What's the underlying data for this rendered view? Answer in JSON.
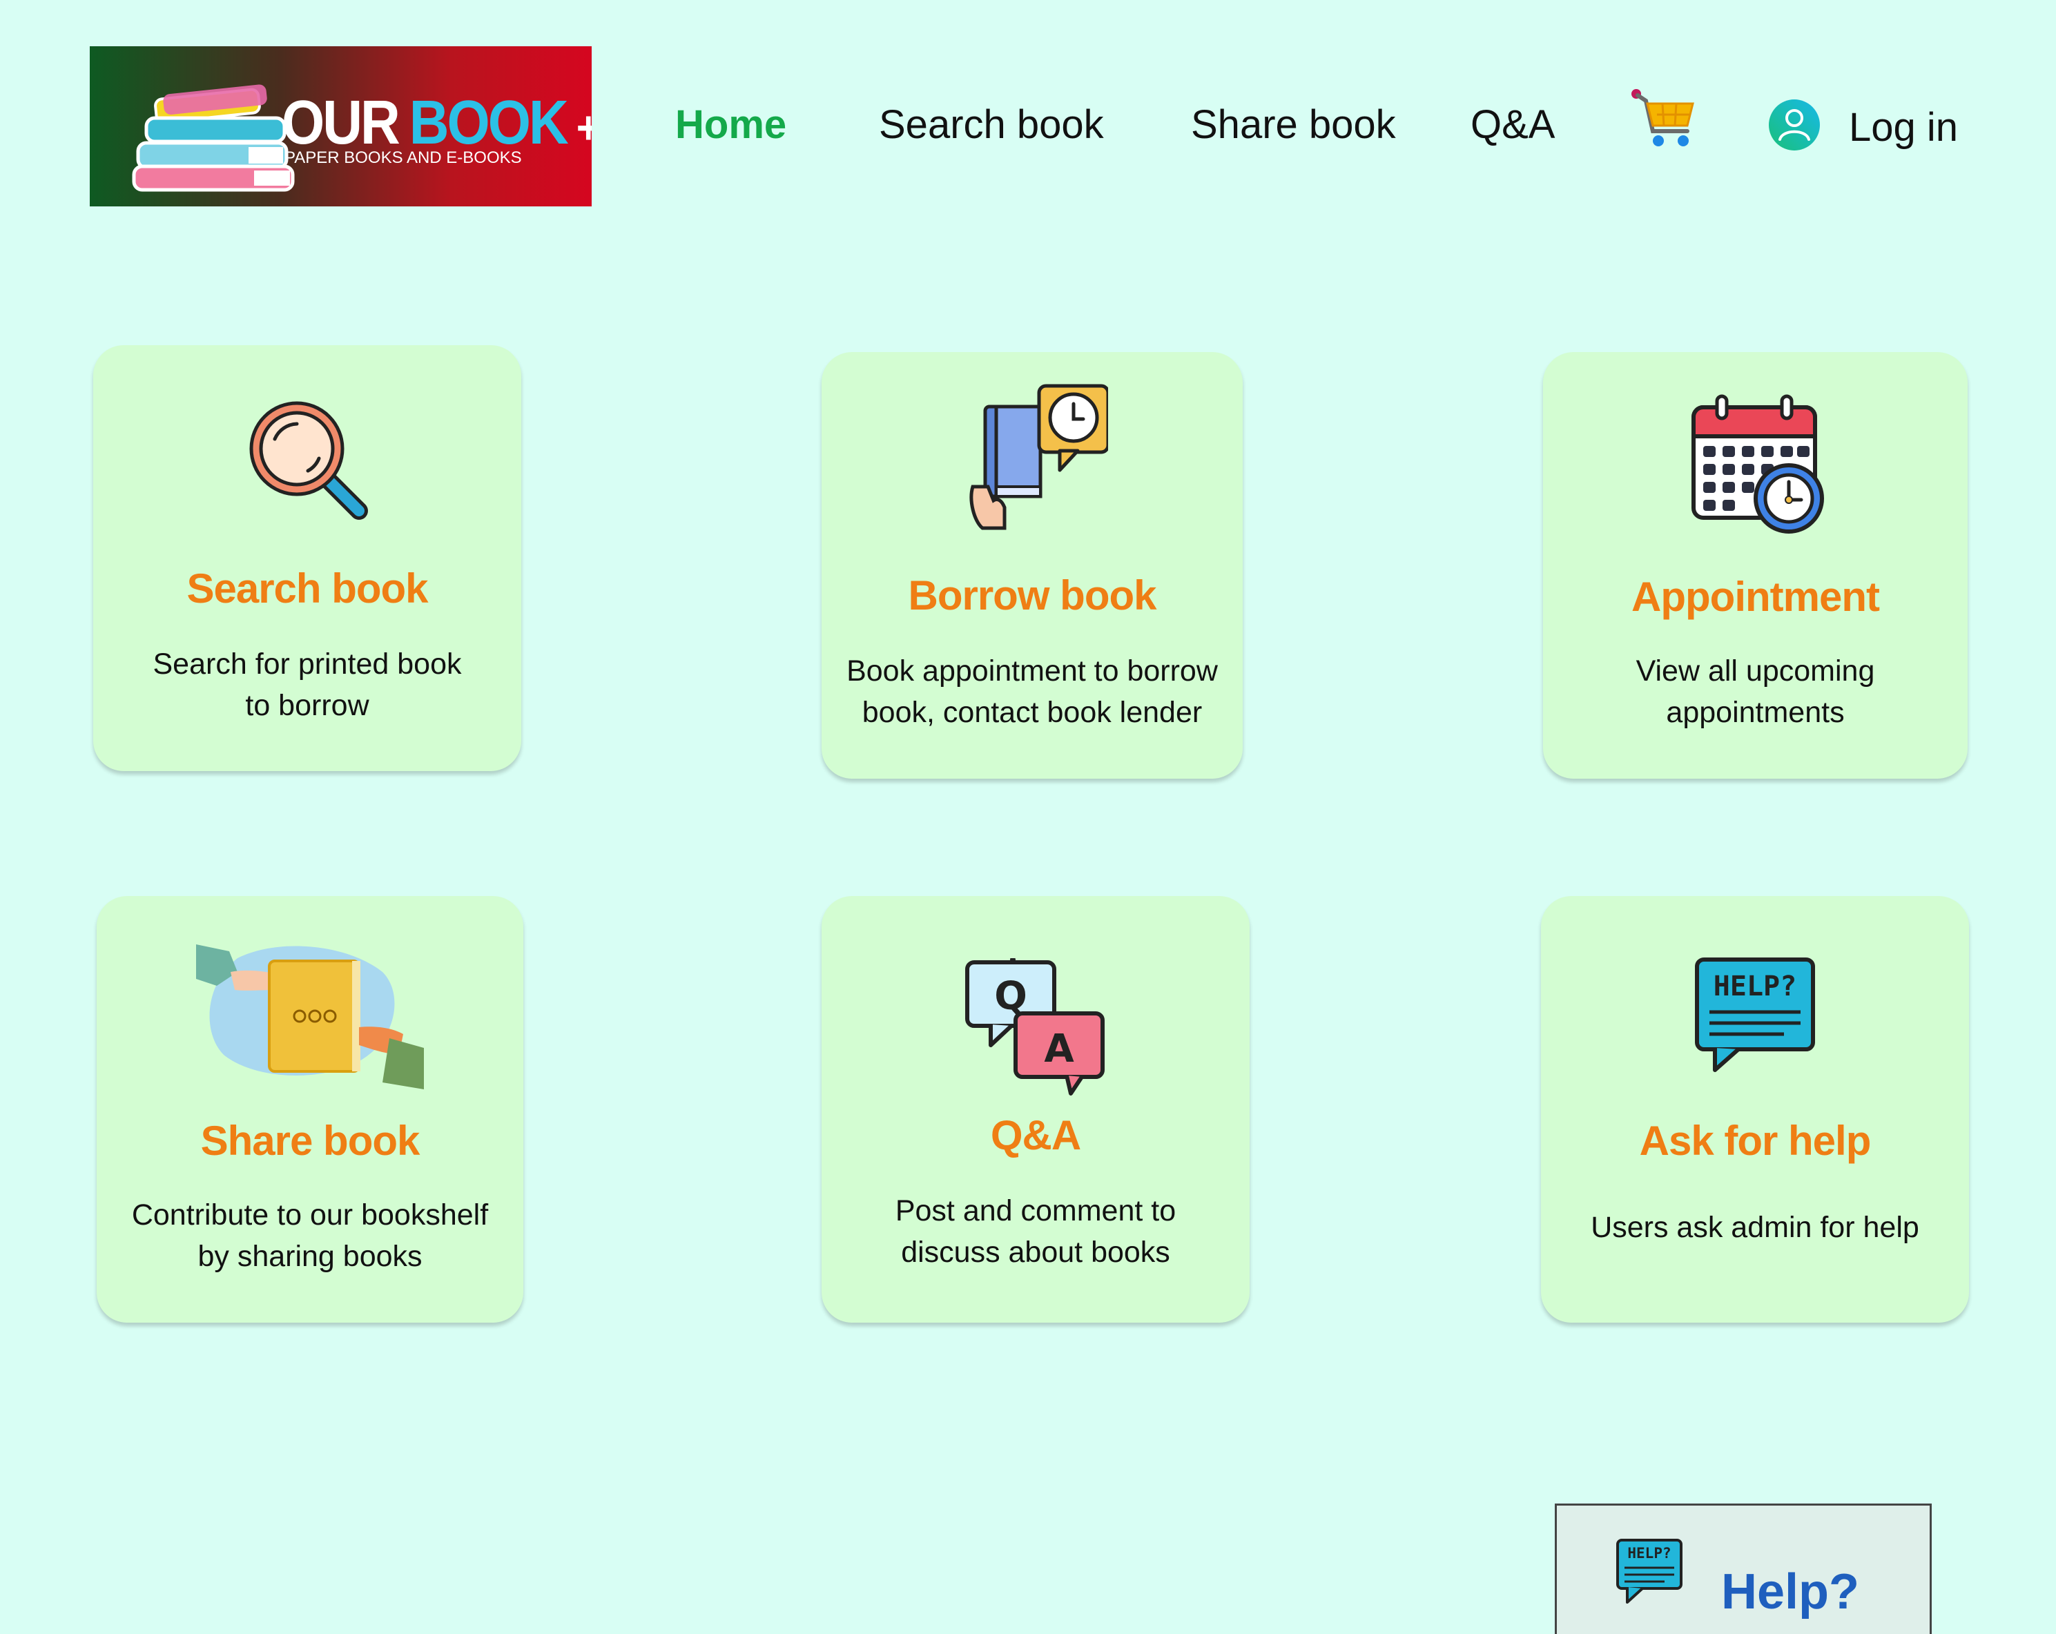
{
  "header": {
    "logo": {
      "brand_word1": "OUR",
      "brand_word2": "BOOK",
      "brand_plus": "+",
      "tagline": "PAPER BOOKS AND E-BOOKS"
    },
    "nav": {
      "home": "Home",
      "search": "Search book",
      "share": "Share book",
      "qa": "Q&A",
      "login": "Log in"
    },
    "icons": {
      "cart": "cart-icon",
      "avatar": "user-avatar-icon"
    }
  },
  "cards": [
    {
      "title": "Search book",
      "desc": "Search for printed book\nto borrow",
      "icon": "magnifier-icon"
    },
    {
      "title": "Borrow book",
      "desc": "Book appointment to borrow\nbook, contact book lender",
      "icon": "book-clock-icon"
    },
    {
      "title": "Appointment",
      "desc": "View all upcoming\nappointments",
      "icon": "calendar-clock-icon"
    },
    {
      "title": "Share book",
      "desc": "Contribute to our bookshelf\nby sharing books",
      "icon": "book-handover-icon"
    },
    {
      "title": "Q&A",
      "desc": "Post and comment to\ndiscuss about books",
      "icon": "qa-bubbles-icon"
    },
    {
      "title": "Ask for help",
      "desc": "Users ask admin for help",
      "icon": "help-bubble-icon"
    }
  ],
  "help_button": {
    "label": "Help?",
    "icon_text": "HELP?"
  },
  "colors": {
    "background": "#d8fef4",
    "card": "#d3fdd2",
    "card_title": "#ef7e14",
    "nav_active": "#14a94a",
    "help_label": "#1f5fbe"
  }
}
